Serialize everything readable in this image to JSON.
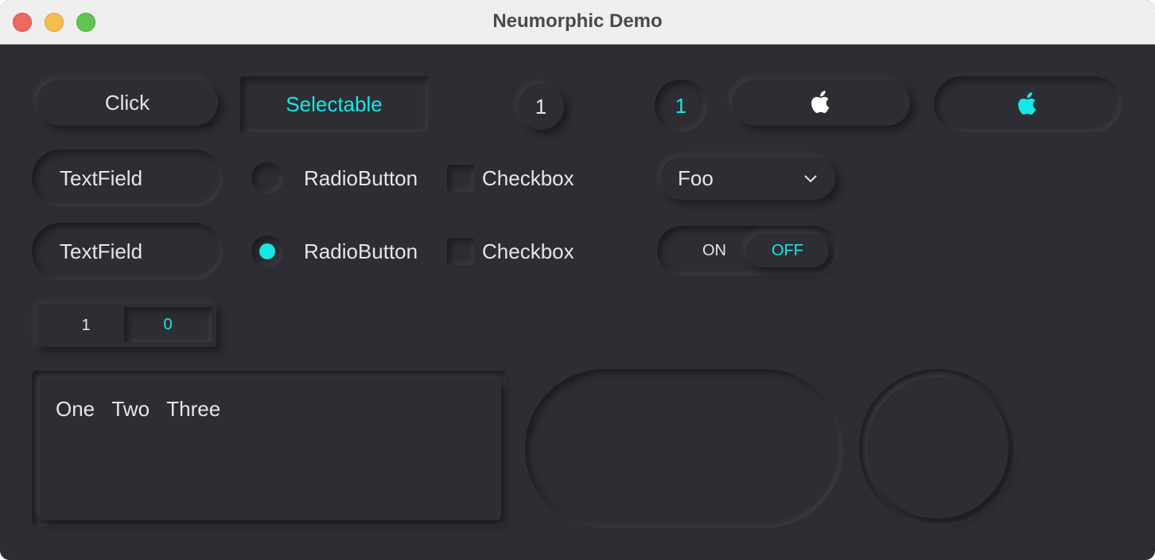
{
  "window": {
    "title": "Neumorphic Demo"
  },
  "row1": {
    "click_label": "Click",
    "selectable_label": "Selectable",
    "counter_plain": "1",
    "counter_selected": "1",
    "apple_icon": "apple-icon",
    "apple_icon_selected": "apple-icon"
  },
  "row2": {
    "textfield_value": "TextField",
    "radio_label": "RadioButton",
    "checkbox_label": "Checkbox",
    "combo_value": "Foo"
  },
  "row3": {
    "textfield_value": "TextField",
    "radio_label": "RadioButton",
    "checkbox_label": "Checkbox",
    "toggle_on": "ON",
    "toggle_off": "OFF"
  },
  "segmented": {
    "left": "1",
    "right": "0"
  },
  "textarea": {
    "value": "One   Two   Three"
  },
  "colors": {
    "background": "#2d2e33",
    "accent": "#19e6e6",
    "text": "#e6e6e8"
  }
}
